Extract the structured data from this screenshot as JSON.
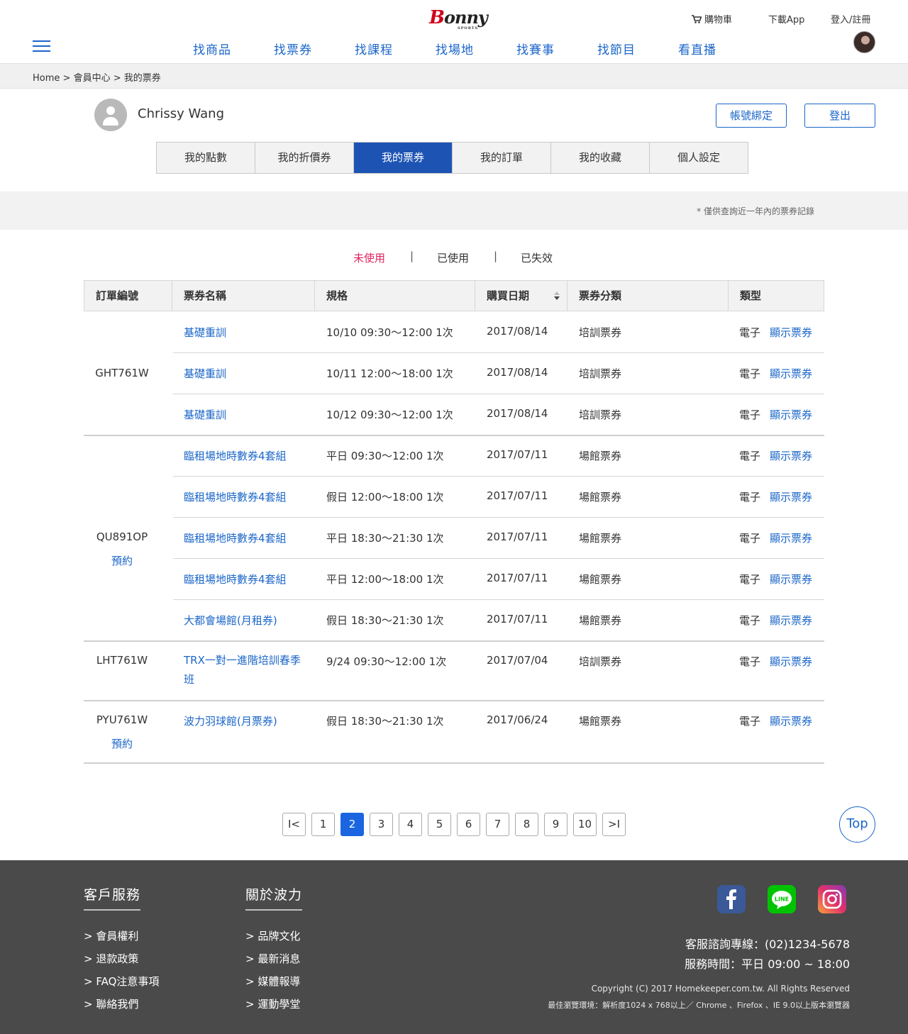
{
  "header": {
    "logo_text": "Bonny",
    "logo_sub": "SPORTS",
    "cart_label": "購物車",
    "app_label": "下載App",
    "login_label": "登入/註冊",
    "nav": [
      "找商品",
      "找票券",
      "找課程",
      "找場地",
      "找賽事",
      "找節目",
      "看直播"
    ],
    "icons": [
      "menu-icon",
      "cart-icon",
      "user-avatar"
    ]
  },
  "breadcrumb": [
    "Home",
    ">",
    "會員中心",
    ">",
    "我的票券"
  ],
  "profile": {
    "name": "Chrissy Wang",
    "bind_label": "帳號綁定",
    "logout_label": "登出"
  },
  "tabs": [
    "我的點數",
    "我的折價券",
    "我的票券",
    "我的訂單",
    "我的收藏",
    "個人設定"
  ],
  "active_tab": "我的票券",
  "note": "* 僅供查詢近一年內的票券記錄",
  "filters": [
    "未使用",
    "已使用",
    "已失效"
  ],
  "filter_sep": "|",
  "table": {
    "headers": [
      "訂單編號",
      "票券名稱",
      "規格",
      "購買日期",
      "票券分類",
      "類型"
    ],
    "orders": [
      {
        "id": "GHT761W",
        "link": ""
      },
      {
        "id": "QU891OP",
        "link": "預約"
      },
      {
        "id": "LHT761W",
        "link": ""
      },
      {
        "id": "PYU761W",
        "link": "預約"
      }
    ],
    "rows": [
      {
        "name": "基礎重訓",
        "spec": "10/10  09:30～12:00  1次",
        "date": "2017/08/14",
        "category": "培訓票券",
        "type": "電子",
        "action": "顯示票券"
      },
      {
        "name": "基礎重訓",
        "spec": "10/11  12:00～18:00  1次",
        "date": "2017/08/14",
        "category": "培訓票券",
        "type": "電子",
        "action": "顯示票券"
      },
      {
        "name": "基礎重訓",
        "spec": "10/12  09:30～12:00  1次",
        "date": "2017/08/14",
        "category": "培訓票券",
        "type": "電子",
        "action": "顯示票券"
      },
      {
        "name": "臨租場地時數券4套組",
        "spec": "平日  09:30～12:00  1次",
        "date": "2017/07/11",
        "category": "場館票券",
        "type": "電子",
        "action": "顯示票券"
      },
      {
        "name": "臨租場地時數券4套組",
        "spec": "假日  12:00～18:00  1次",
        "date": "2017/07/11",
        "category": "場館票券",
        "type": "電子",
        "action": "顯示票券"
      },
      {
        "name": "臨租場地時數券4套組",
        "spec": "平日  18:30～21:30  1次",
        "date": "2017/07/11",
        "category": "場館票券",
        "type": "電子",
        "action": "顯示票券"
      },
      {
        "name": "臨租場地時數券4套組",
        "spec": "平日  12:00～18:00  1次",
        "date": "2017/07/11",
        "category": "場館票券",
        "type": "電子",
        "action": "顯示票券"
      },
      {
        "name": "大都會場館(月租券)",
        "spec": "假日   18:30～21:30  1次",
        "date": "2017/07/11",
        "category": "場館票券",
        "type": "電子",
        "action": "顯示票券"
      },
      {
        "name": "TRX一對一進階培訓春季班",
        "spec": "9/24  09:30～12:00  1次",
        "date": "2017/07/04",
        "category": "培訓票券",
        "type": "電子",
        "action": "顯示票券"
      },
      {
        "name": "波力羽球館(月票券)",
        "spec": "假日   18:30～21:30  1次",
        "date": "2017/06/24",
        "category": "場館票券",
        "type": "電子",
        "action": "顯示票券"
      }
    ]
  },
  "pagination": {
    "first": "I<",
    "pages": [
      "1",
      "2",
      "3",
      "4",
      "5",
      "6",
      "7",
      "8",
      "9",
      "10"
    ],
    "last": ">I",
    "current": "2"
  },
  "top_label": "Top",
  "footer": {
    "service_title": "客戶服務",
    "service_links": [
      "> 會員權利",
      "> 退款政策",
      "> FAQ注意事項",
      "> 聯絡我們"
    ],
    "about_title": "關於波力",
    "about_links": [
      "> 品牌文化",
      "> 最新消息",
      "> 媒體報導",
      "> 運動學堂"
    ],
    "social_icons": [
      "facebook-icon",
      "line-icon",
      "instagram-icon"
    ],
    "hotline": "客服諮詢專線：(02)1234-5678",
    "hours": "服務時間：平日 09:00 ~ 18:00",
    "copyright": "Copyright (C) 2017 Homekeeper.com.tw. All Rights Reserved",
    "browser": "最佳瀏覽環境：解析度1024 x 768以上／ Chrome  、Firefox  、IE 9.0以上版本瀏覽器"
  },
  "colors": {
    "accent": "#1b66c9",
    "tab_active": "#1d54b4",
    "filter_active": "#e0245e",
    "footer_bg": "#4a4a4a"
  }
}
